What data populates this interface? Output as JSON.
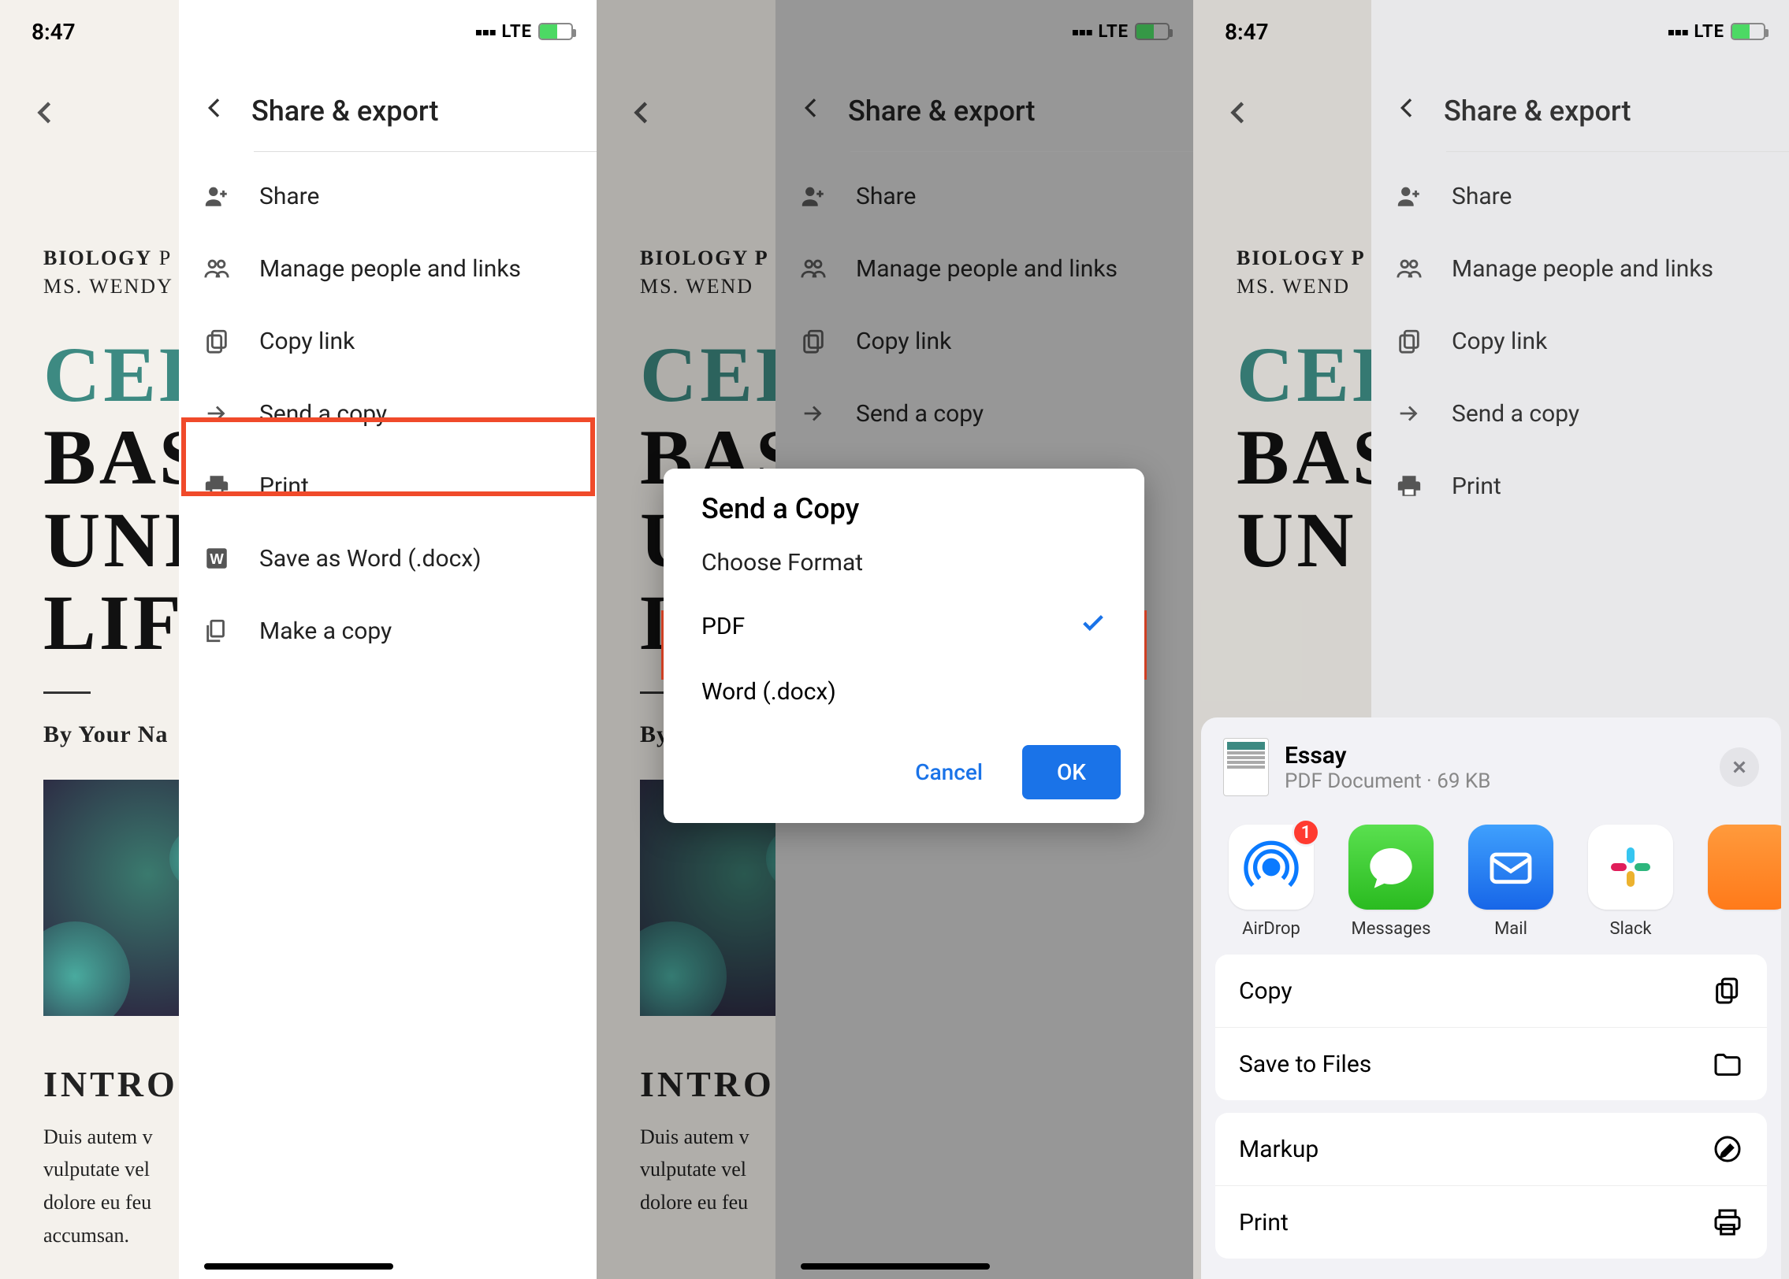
{
  "status": {
    "time": "8:47",
    "network": "LTE"
  },
  "document": {
    "meta_line1_strong": "BIOLOGY",
    "meta_line1_rest": " P",
    "meta_line2": "MS. WENDY",
    "title_line1": "CEL",
    "title_line2a": "BAS",
    "title_line2b": "UNI",
    "title_line2c": "LIF",
    "byline": "By Your Na",
    "heading": "INTROI",
    "body": "Duis autem v\nvulputate vel\ndolore eu feu\naccumsan."
  },
  "document_mid": {
    "meta_line1": "BIOLOGY P",
    "meta_line2": "MS. WEND",
    "title_line1": "CEL",
    "title_line2a": "BAS",
    "title_line2b": "UN",
    "title_line2c": "LIF",
    "byline": "By Your N",
    "heading": "INTROI",
    "body": "Duis autem v\nvulputate vel\ndolore eu feu"
  },
  "sheet": {
    "title": "Share & export",
    "items": {
      "share": "Share",
      "manage": "Manage people and links",
      "copy_link": "Copy link",
      "send_copy": "Send a copy",
      "print": "Print",
      "save_word": "Save as Word (.docx)",
      "make_copy": "Make a copy"
    }
  },
  "modal": {
    "title": "Send a Copy",
    "subtitle": "Choose Format",
    "options": {
      "pdf": "PDF",
      "word": "Word (.docx)"
    },
    "cancel": "Cancel",
    "ok": "OK"
  },
  "ios_share": {
    "file_title": "Essay",
    "file_sub": "PDF Document · 69 KB",
    "apps": {
      "airdrop": "AirDrop",
      "airdrop_badge": "1",
      "messages": "Messages",
      "mail": "Mail",
      "slack": "Slack"
    },
    "actions": {
      "copy": "Copy",
      "save_files": "Save to Files",
      "markup": "Markup",
      "print": "Print"
    }
  }
}
